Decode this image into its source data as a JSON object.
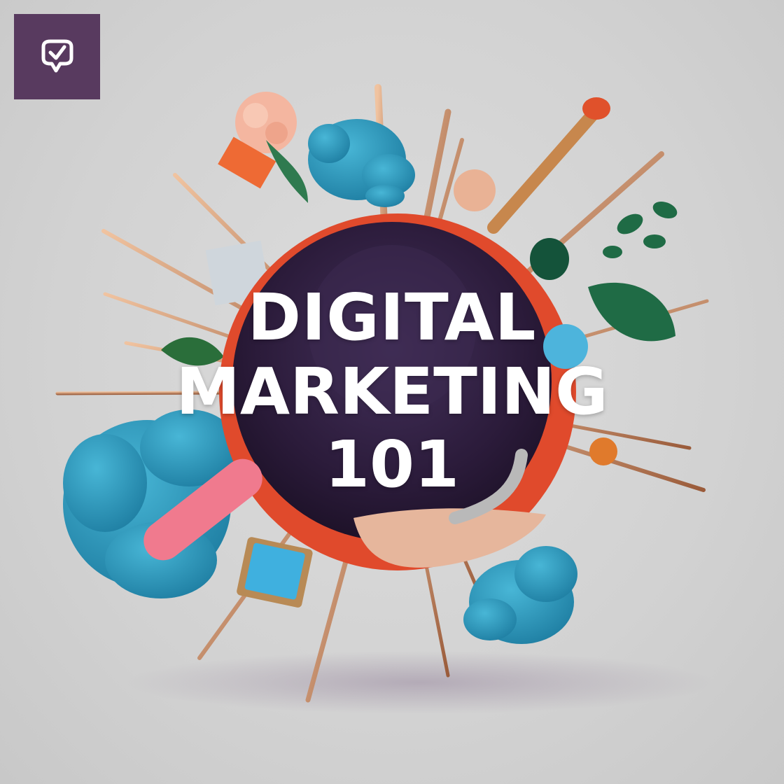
{
  "title": {
    "line1": "DIGITAL",
    "line2": "MARKETING",
    "line3": "101"
  },
  "logo": {
    "icon": "chat-check-icon",
    "background": "#583a5f"
  },
  "colors": {
    "background": "#d4d4d4",
    "sphere": "#2e1d3d",
    "ring": "#e04a2c",
    "blob": "#2e9ec0",
    "accent_pink": "#f07a8e",
    "leaf": "#1f6b45"
  }
}
